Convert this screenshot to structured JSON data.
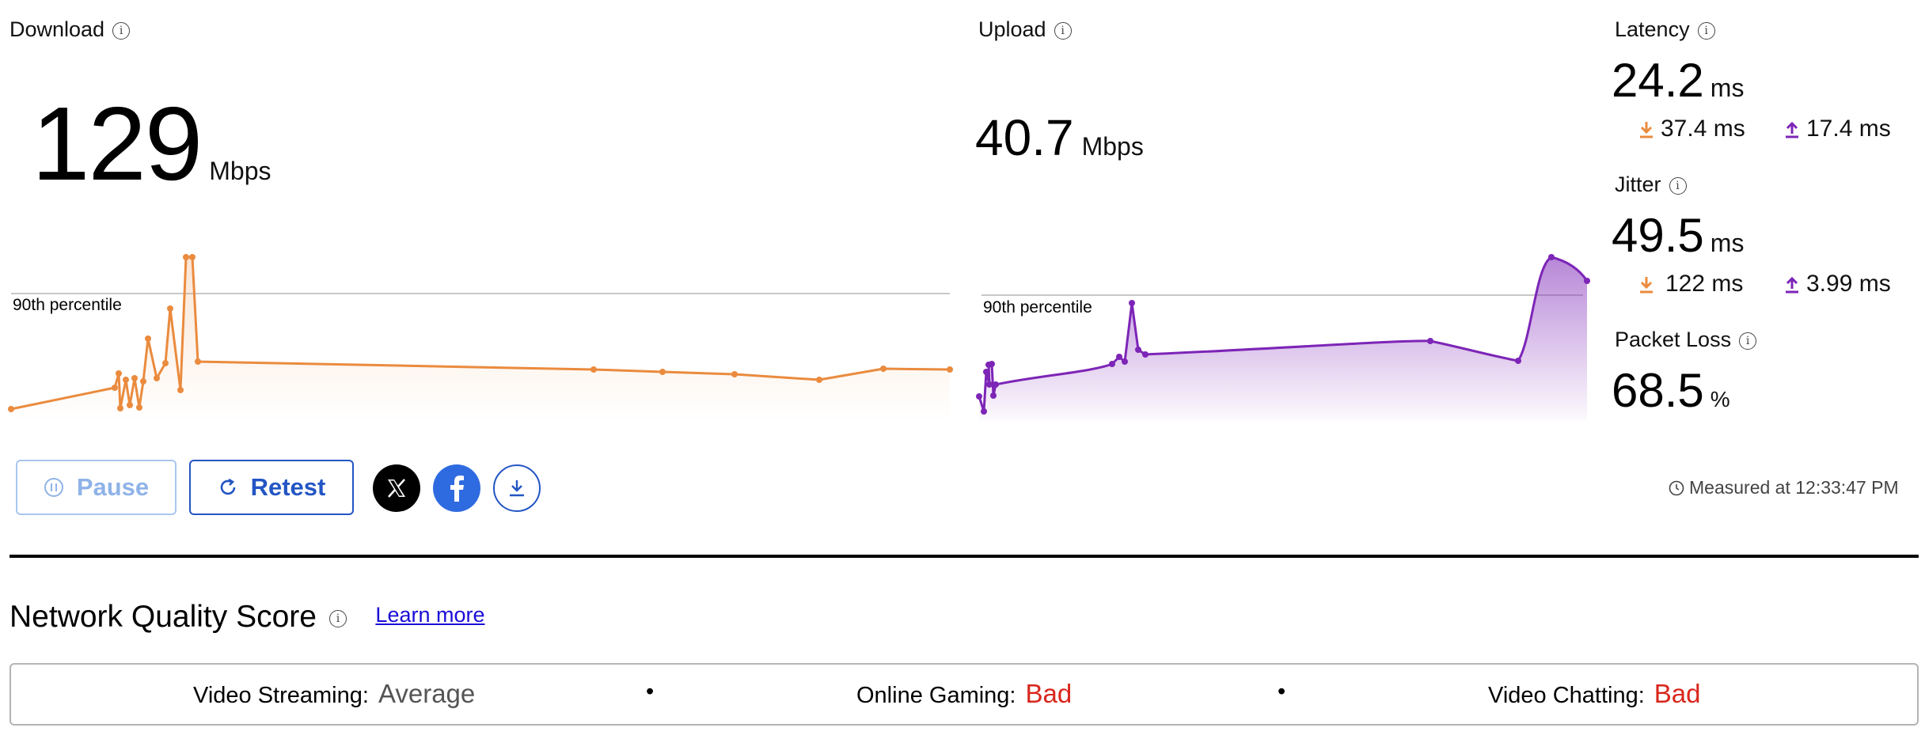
{
  "download": {
    "label": "Download",
    "value": "129",
    "unit": "Mbps",
    "percentile_label": "90th percentile",
    "color": "#ea8b3e"
  },
  "upload": {
    "label": "Upload",
    "value": "40.7",
    "unit": "Mbps",
    "percentile_label": "90th percentile",
    "color": "#7d25b7"
  },
  "latency": {
    "label": "Latency",
    "value": "24.2",
    "unit": "ms",
    "down_value": "37.4 ms",
    "up_value": "17.4 ms"
  },
  "jitter": {
    "label": "Jitter",
    "value": "49.5",
    "unit": "ms",
    "down_value": "122 ms",
    "up_value": "3.99 ms"
  },
  "packet_loss": {
    "label": "Packet Loss",
    "value": "68.5",
    "unit": "%"
  },
  "actions": {
    "pause_label": "Pause",
    "retest_label": "Retest",
    "x_icon": "x-logo-icon",
    "facebook_icon": "facebook-icon",
    "download_icon": "download-icon"
  },
  "measured": {
    "text": "Measured at 12:33:47 PM"
  },
  "quality": {
    "title": "Network Quality Score",
    "learn_more": "Learn more",
    "bullet": "•",
    "items": [
      {
        "label": "Video Streaming:",
        "value": "Average",
        "color": "#555555"
      },
      {
        "label": "Online Gaming:",
        "value": "Bad",
        "color": "#d9261c"
      },
      {
        "label": "Video Chatting:",
        "value": "Bad",
        "color": "#d9261c"
      }
    ]
  },
  "colors": {
    "accent_blue": "#2355c4",
    "bad_red": "#d9261c",
    "download_orange": "#ea8b3e",
    "upload_purple": "#7d25b7"
  }
}
